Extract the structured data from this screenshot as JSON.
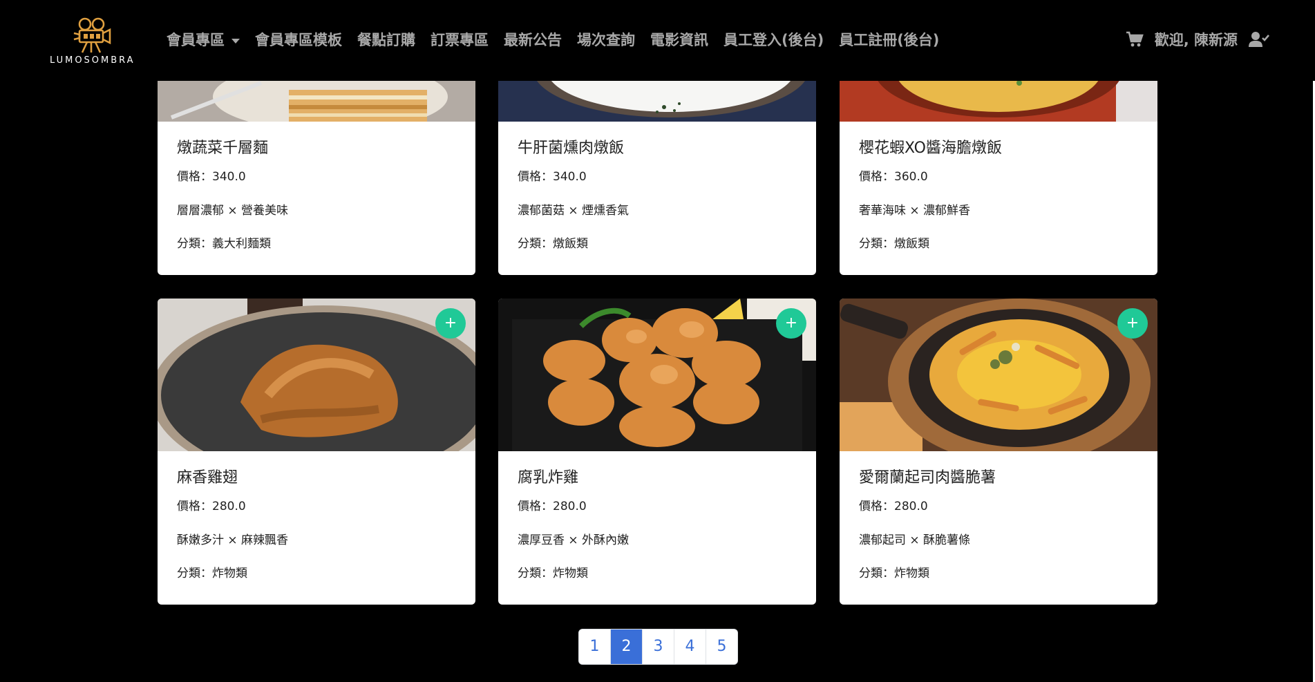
{
  "navbar": {
    "brand": "LUMOSOMBRA",
    "links": [
      {
        "label": "會員專區",
        "dropdown": true
      },
      {
        "label": "會員專區模板"
      },
      {
        "label": "餐點訂購"
      },
      {
        "label": "訂票專區"
      },
      {
        "label": "最新公告"
      },
      {
        "label": "場次查詢"
      },
      {
        "label": "電影資訊"
      },
      {
        "label": "員工登入(後台)"
      },
      {
        "label": "員工註冊(後台)"
      }
    ],
    "welcome": "歡迎, 陳新源",
    "cart_icon": "cart-icon",
    "user_icon": "user-check-icon"
  },
  "products": [
    {
      "name": "燉蔬菜千層麵",
      "price": "價格：340.0",
      "desc": "層層濃郁 × 營養美味",
      "category": "分類：義大利麵類"
    },
    {
      "name": "牛肝菌燻肉燉飯",
      "price": "價格：340.0",
      "desc": "濃郁菌菇 × 煙燻香氣",
      "category": "分類：燉飯類"
    },
    {
      "name": "櫻花蝦XO醬海膽燉飯",
      "price": "價格：360.0",
      "desc": "奢華海味 × 濃郁鮮香",
      "category": "分類：燉飯類"
    },
    {
      "name": "麻香雞翅",
      "price": "價格：280.0",
      "desc": "酥嫩多汁 × 麻辣飄香",
      "category": "分類：炸物類",
      "add": "+"
    },
    {
      "name": "腐乳炸雞",
      "price": "價格：280.0",
      "desc": "濃厚豆香 × 外酥內嫩",
      "category": "分類：炸物類",
      "add": "+"
    },
    {
      "name": "愛爾蘭起司肉醬脆薯",
      "price": "價格：280.0",
      "desc": "濃郁起司 × 酥脆薯條",
      "category": "分類：炸物類",
      "add": "+"
    }
  ],
  "pagination": {
    "pages": [
      "1",
      "2",
      "3",
      "4",
      "5"
    ],
    "current": "2"
  },
  "colors": {
    "accent": "#3a6fd8",
    "add_button": "#20c997",
    "nav_text": "#a8a8a8",
    "brand_gold": "#e0a040"
  }
}
